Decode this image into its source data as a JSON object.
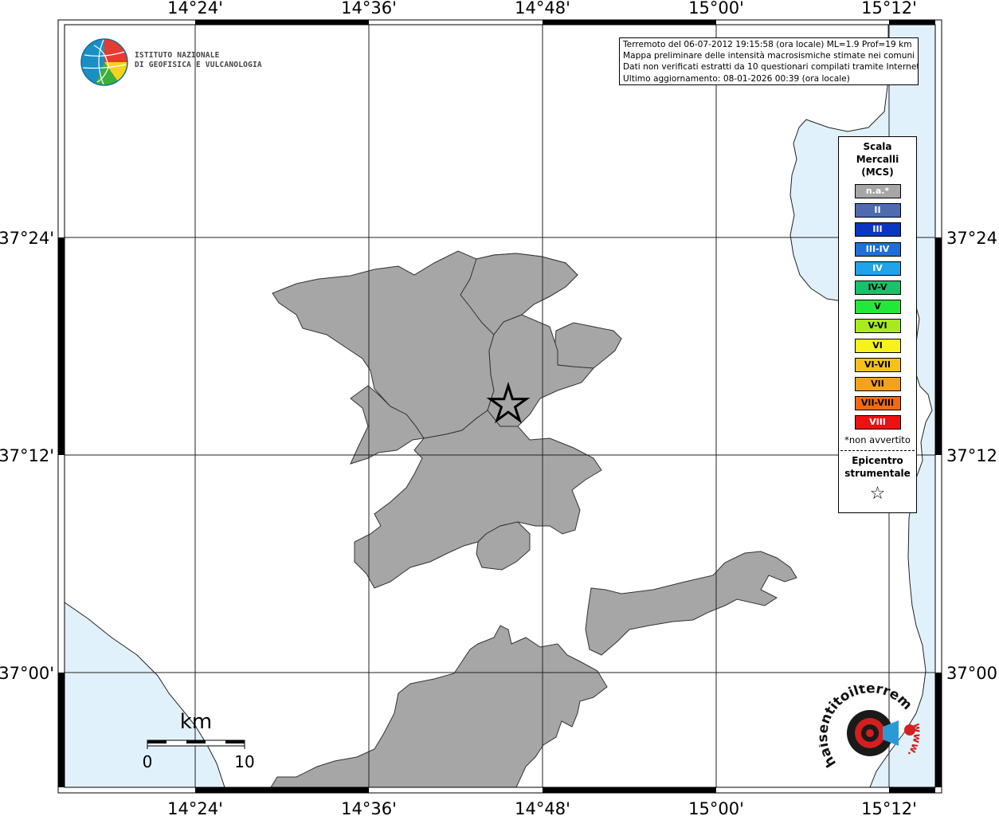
{
  "info_box": {
    "lines": [
      "Terremoto del 06-07-2012 19:15:58 (ora locale) ML=1.9 Prof=19 km",
      "Mappa preliminare delle intensità macrosismiche stimate nei comuni",
      "Dati non verificati estratti da 10 questionari compilati tramite Internet.",
      "Ultimo aggiornamento: 08-01-2026 00:39 (ora locale)"
    ]
  },
  "legend": {
    "title_lines": [
      "Scala",
      "Mercalli",
      "(MCS)"
    ],
    "items": [
      {
        "label": "n.a.*",
        "color": "#a6a6a6",
        "text_color": "#ffffff"
      },
      {
        "label": "II",
        "color": "#4f6bb0",
        "text_color": "#ffffff"
      },
      {
        "label": "III",
        "color": "#0a36c2",
        "text_color": "#ffffff"
      },
      {
        "label": "III-IV",
        "color": "#1f6fd8",
        "text_color": "#ffffff"
      },
      {
        "label": "IV",
        "color": "#1fa4ea",
        "text_color": "#ffffff"
      },
      {
        "label": "IV-V",
        "color": "#18c16a",
        "text_color": "#000000"
      },
      {
        "label": "V",
        "color": "#22e83a",
        "text_color": "#000000"
      },
      {
        "label": "V-VI",
        "color": "#a8ea1e",
        "text_color": "#000000"
      },
      {
        "label": "VI",
        "color": "#f6f21d",
        "text_color": "#000000"
      },
      {
        "label": "VI-VII",
        "color": "#f5c21a",
        "text_color": "#000000"
      },
      {
        "label": "VII",
        "color": "#f5a21a",
        "text_color": "#000000"
      },
      {
        "label": "VII-VIII",
        "color": "#f06a14",
        "text_color": "#000000"
      },
      {
        "label": "VIII",
        "color": "#ec1212",
        "text_color": "#ffffff"
      }
    ],
    "note": "*non avvertito",
    "epicenter_lines": [
      "Epicentro",
      "strumentale"
    ],
    "epicenter_symbol": "☆"
  },
  "axes": {
    "lon_ticks": [
      "14°24'",
      "14°36'",
      "14°48'",
      "15°00'",
      "15°12'"
    ],
    "lat_ticks": [
      "37°24'",
      "37°12'",
      "37°00'"
    ]
  },
  "scale_bar": {
    "unit": "km",
    "start_label": "0",
    "end_label": "10"
  },
  "ingv_logo": {
    "lines": [
      "ISTITUTO NAZIONALE",
      "DI GEOFISICA E VULCANOLOGIA"
    ]
  },
  "hst_logo": {
    "text": "haisentitoilterremoto.it",
    "prefix": "www."
  },
  "colors": {
    "sea": "#e1f1fb",
    "land": "#ffffff",
    "municipality": "#a6a6a6",
    "border": "#000000"
  },
  "epicenter": {
    "lon": "14°44.8'",
    "lat": "37°13.8'"
  }
}
